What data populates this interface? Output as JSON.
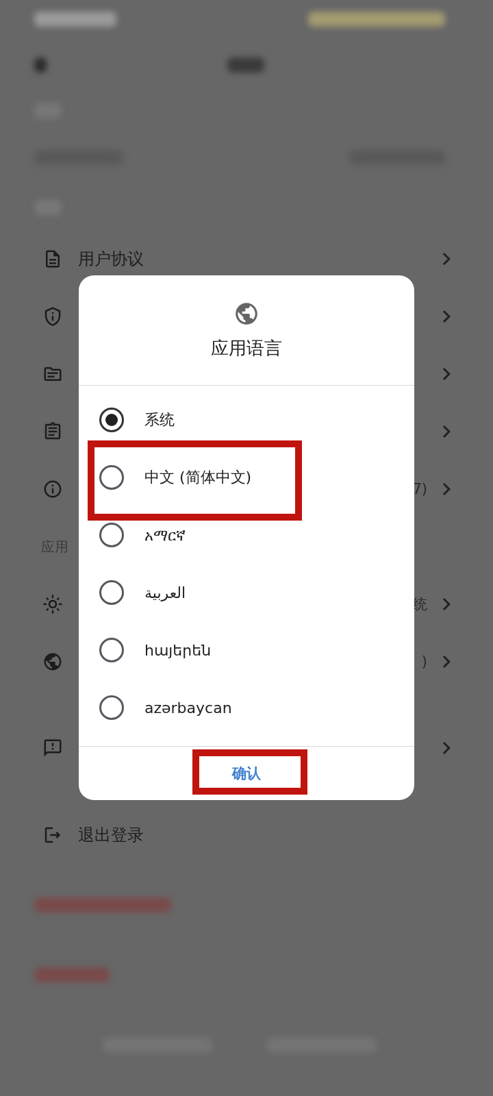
{
  "settings_rows": [
    {
      "kind": "document",
      "label": "用户协议"
    },
    {
      "kind": "shield"
    },
    {
      "kind": "folder"
    },
    {
      "kind": "clipboard"
    },
    {
      "kind": "info",
      "value": "7)"
    }
  ],
  "section_label": "应用",
  "app_rows": [
    {
      "kind": "sun",
      "value": "统"
    },
    {
      "kind": "globe",
      "value": ")"
    },
    {
      "kind": "feedback"
    }
  ],
  "logout": {
    "label": "退出登录"
  },
  "dialog": {
    "title": "应用语言",
    "options": [
      {
        "label": "系统",
        "selected": true,
        "highlighted": false
      },
      {
        "label": "中文 (简体中文)",
        "selected": false,
        "highlighted": true
      },
      {
        "label": "አማርኛ",
        "selected": false,
        "highlighted": false
      },
      {
        "label": "العربية",
        "selected": false,
        "highlighted": false
      },
      {
        "label": "հայերեն",
        "selected": false,
        "highlighted": false
      },
      {
        "label": "azərbaycan",
        "selected": false,
        "highlighted": false
      }
    ],
    "confirm": {
      "label": "确认",
      "highlighted": true
    }
  }
}
